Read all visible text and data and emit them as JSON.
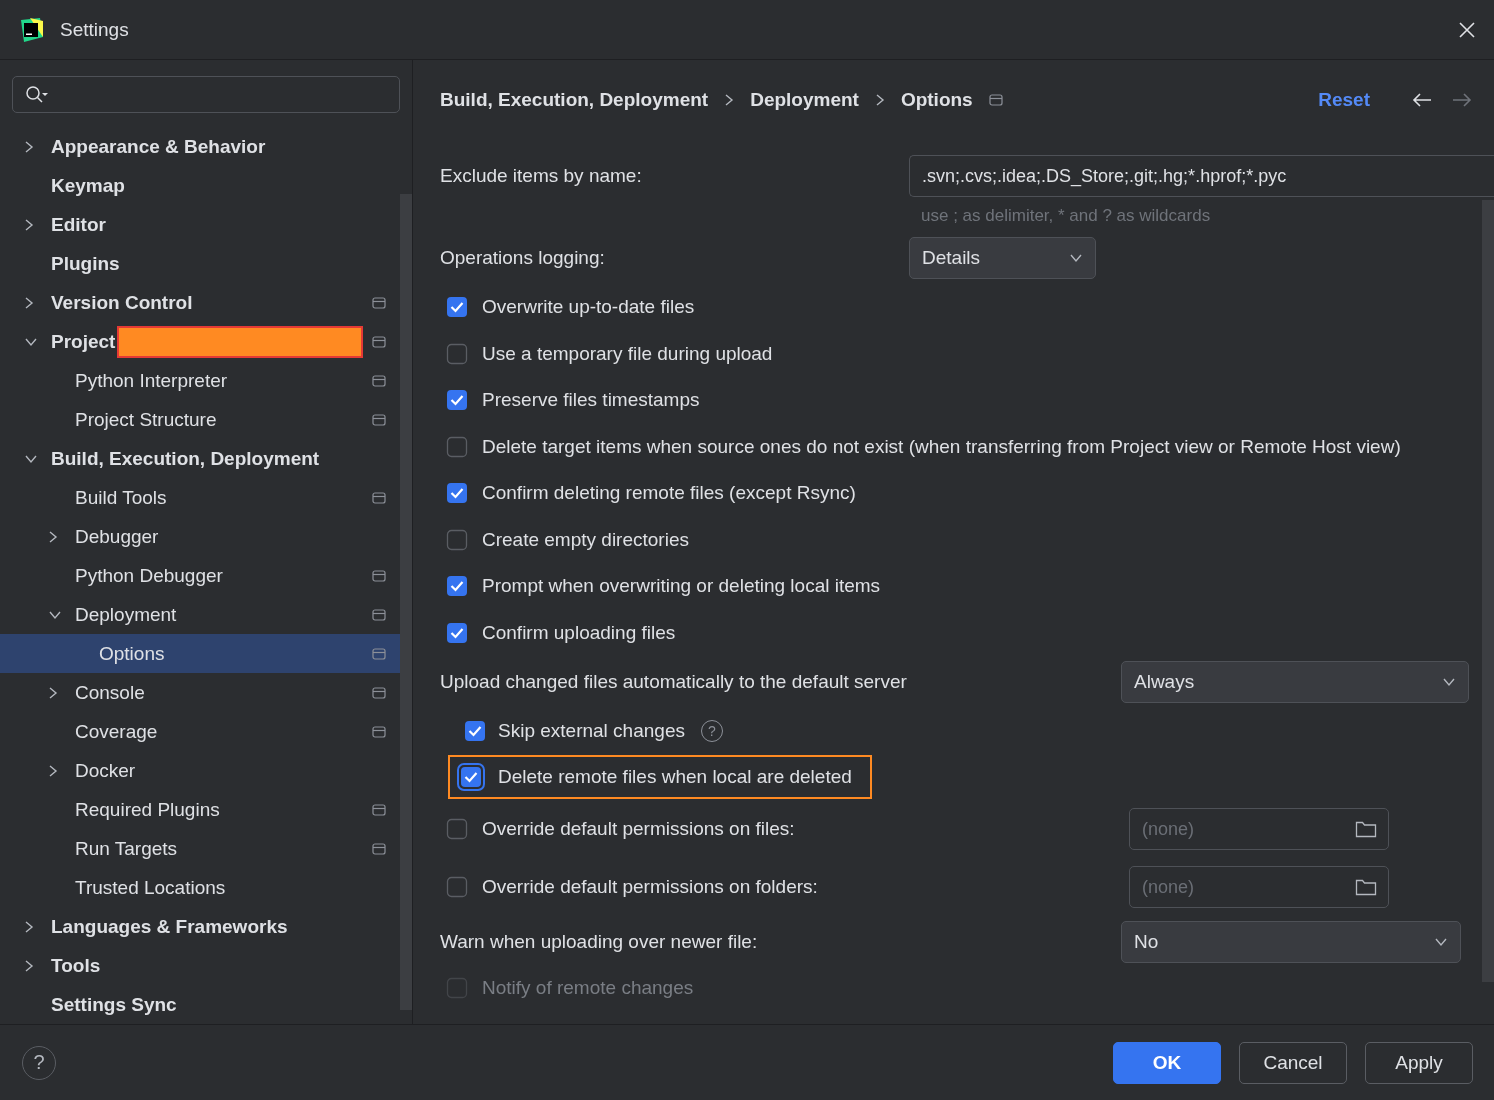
{
  "window": {
    "title": "Settings"
  },
  "sidebar": {
    "items": [
      {
        "label": "Appearance & Behavior",
        "expanded": false,
        "has_children": true,
        "scope_icon": false,
        "selected": false
      },
      {
        "label": "Keymap",
        "has_children": false,
        "scope_icon": false,
        "selected": false
      },
      {
        "label": "Editor",
        "expanded": false,
        "has_children": true,
        "scope_icon": false,
        "selected": false
      },
      {
        "label": "Plugins",
        "has_children": false,
        "scope_icon": false,
        "selected": false
      },
      {
        "label": "Version Control",
        "expanded": false,
        "has_children": true,
        "scope_icon": true,
        "selected": false
      },
      {
        "label": "Project",
        "redacted": true,
        "expanded": true,
        "has_children": true,
        "scope_icon": true,
        "selected": false,
        "children": [
          {
            "label": "Python Interpreter",
            "has_children": false,
            "scope_icon": true,
            "selected": false
          },
          {
            "label": "Project Structure",
            "has_children": false,
            "scope_icon": true,
            "selected": false
          }
        ]
      },
      {
        "label": "Build, Execution, Deployment",
        "expanded": true,
        "has_children": true,
        "scope_icon": false,
        "selected": false,
        "children": [
          {
            "label": "Build Tools",
            "has_children": false,
            "scope_icon": true,
            "selected": false
          },
          {
            "label": "Debugger",
            "expanded": false,
            "has_children": true,
            "scope_icon": false,
            "selected": false
          },
          {
            "label": "Python Debugger",
            "has_children": false,
            "scope_icon": true,
            "selected": false
          },
          {
            "label": "Deployment",
            "expanded": true,
            "has_children": true,
            "scope_icon": true,
            "selected": false,
            "children": [
              {
                "label": "Options",
                "has_children": false,
                "scope_icon": true,
                "selected": true
              }
            ]
          },
          {
            "label": "Console",
            "expanded": false,
            "has_children": true,
            "scope_icon": true,
            "selected": false
          },
          {
            "label": "Coverage",
            "has_children": false,
            "scope_icon": true,
            "selected": false
          },
          {
            "label": "Docker",
            "expanded": false,
            "has_children": true,
            "scope_icon": false,
            "selected": false
          },
          {
            "label": "Required Plugins",
            "has_children": false,
            "scope_icon": true,
            "selected": false
          },
          {
            "label": "Run Targets",
            "has_children": false,
            "scope_icon": true,
            "selected": false
          },
          {
            "label": "Trusted Locations",
            "has_children": false,
            "scope_icon": false,
            "selected": false
          }
        ]
      },
      {
        "label": "Languages & Frameworks",
        "expanded": false,
        "has_children": true,
        "scope_icon": false,
        "selected": false
      },
      {
        "label": "Tools",
        "expanded": false,
        "has_children": true,
        "scope_icon": false,
        "selected": false
      },
      {
        "label": "Settings Sync",
        "has_children": false,
        "scope_icon": false,
        "selected": false
      }
    ]
  },
  "breadcrumb": {
    "items": [
      "Build, Execution, Deployment",
      "Deployment",
      "Options"
    ],
    "reset": "Reset"
  },
  "settings": [
    {
      "kind": "text_field",
      "label": "Exclude items by name:",
      "value": ".svn;.cvs;.idea;.DS_Store;.git;.hg;*.hprof;*.pyc",
      "hint": "use ; as delimiter, * and ? as wildcards"
    },
    {
      "kind": "dropdown",
      "label": "Operations logging:",
      "value": "Details"
    },
    {
      "kind": "checkbox",
      "label": "Overwrite up-to-date files",
      "checked": true
    },
    {
      "kind": "checkbox",
      "label": "Use a temporary file during upload",
      "checked": false
    },
    {
      "kind": "checkbox",
      "label": "Preserve files timestamps",
      "checked": true
    },
    {
      "kind": "checkbox",
      "label": "Delete target items when source ones do not exist (when transferring from Project view or Remote Host view)",
      "checked": false
    },
    {
      "kind": "checkbox",
      "label": "Confirm deleting remote files (except Rsync)",
      "checked": true
    },
    {
      "kind": "checkbox",
      "label": "Create empty directories",
      "checked": false
    },
    {
      "kind": "checkbox",
      "label": "Prompt when overwriting or deleting local items",
      "checked": true
    },
    {
      "kind": "checkbox",
      "label": "Confirm uploading files",
      "checked": true
    },
    {
      "kind": "dropdown",
      "label": "Upload changed files automatically to the default server",
      "value": "Always",
      "children": [
        {
          "label": "Skip external changes",
          "checked": true,
          "help": "?",
          "highlighted": false
        },
        {
          "label": "Delete remote files when local are deleted",
          "checked": true,
          "highlighted": true
        }
      ]
    },
    {
      "kind": "path_checkbox",
      "label": "Override default permissions on files:",
      "checked": false,
      "placeholder": "(none)"
    },
    {
      "kind": "path_checkbox",
      "label": "Override default permissions on folders:",
      "checked": false,
      "placeholder": "(none)"
    },
    {
      "kind": "dropdown",
      "label": "Warn when uploading over newer file:",
      "value": "No"
    },
    {
      "kind": "obscured_checkbox",
      "label": "Notify of remote changes",
      "checked": false
    }
  ],
  "footer": {
    "help": "?",
    "buttons": [
      {
        "label": "OK",
        "primary": true
      },
      {
        "label": "Cancel",
        "primary": false
      },
      {
        "label": "Apply",
        "primary": false
      }
    ]
  }
}
